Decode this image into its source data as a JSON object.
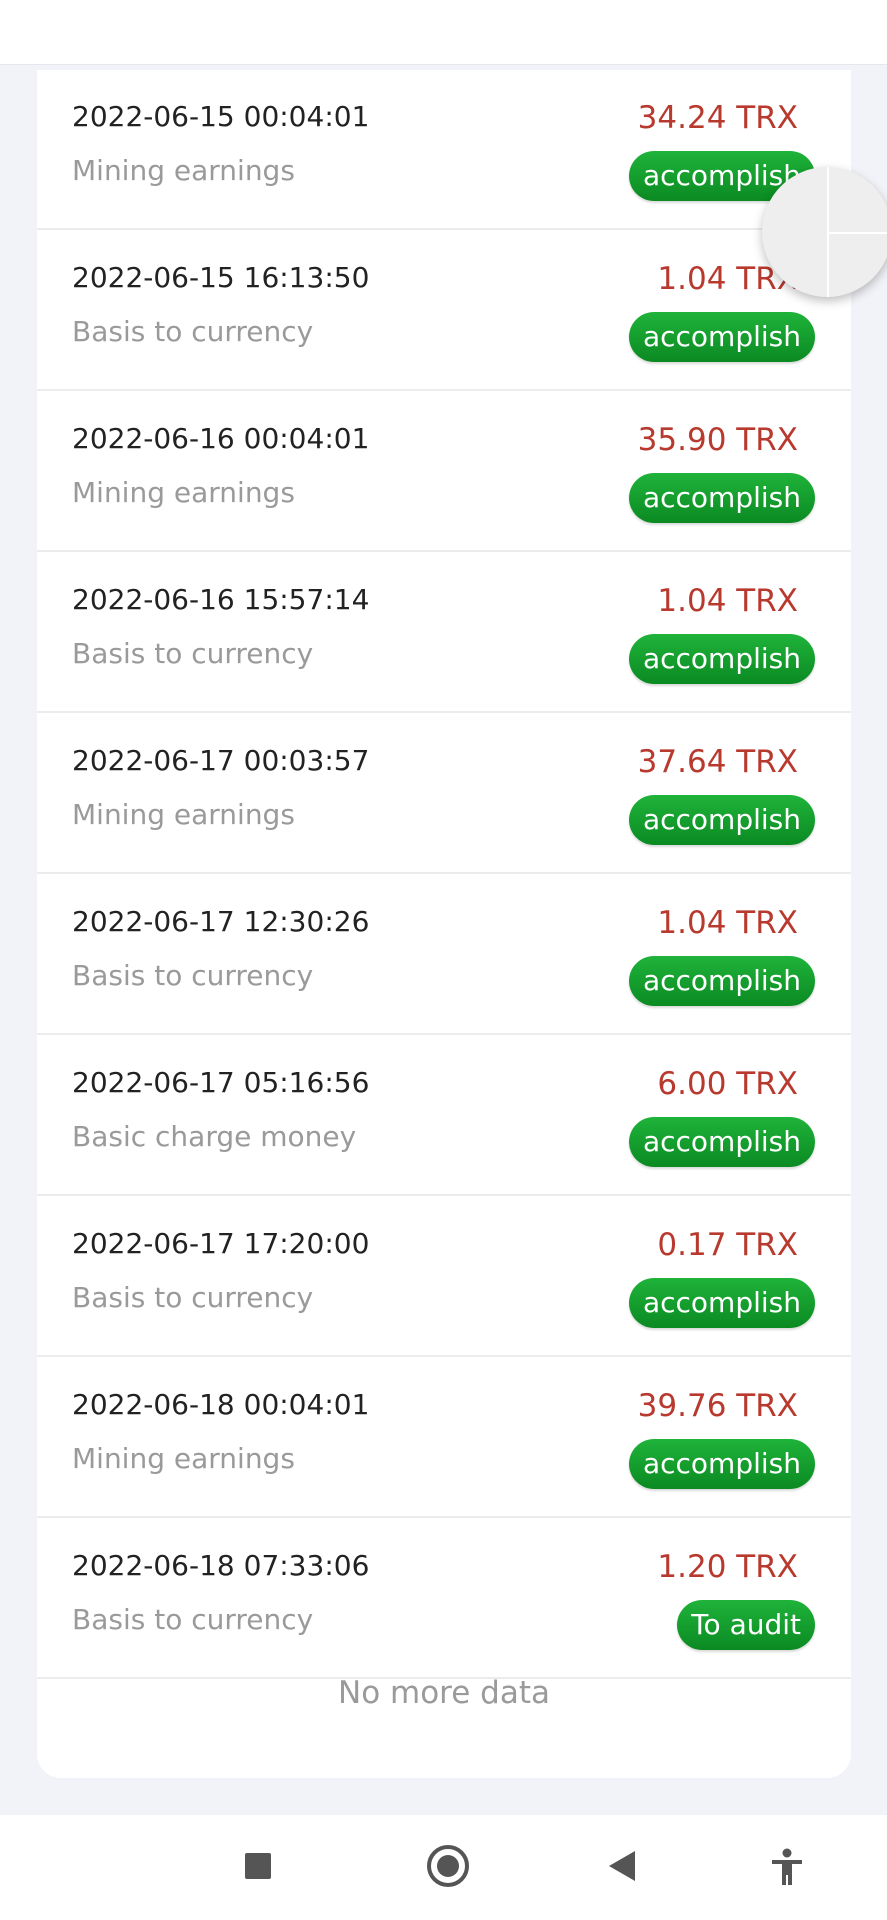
{
  "records": [
    {
      "date": "2022-06-15 00:04:01",
      "description": "Mining earnings",
      "amount": "34.24 TRX",
      "status": "accomplish"
    },
    {
      "date": "2022-06-15 16:13:50",
      "description": "Basis to currency",
      "amount": "1.04 TRX",
      "status": "accomplish"
    },
    {
      "date": "2022-06-16 00:04:01",
      "description": "Mining earnings",
      "amount": "35.90 TRX",
      "status": "accomplish"
    },
    {
      "date": "2022-06-16 15:57:14",
      "description": "Basis to currency",
      "amount": "1.04 TRX",
      "status": "accomplish"
    },
    {
      "date": "2022-06-17 00:03:57",
      "description": "Mining earnings",
      "amount": "37.64 TRX",
      "status": "accomplish"
    },
    {
      "date": "2022-06-17 12:30:26",
      "description": "Basis to currency",
      "amount": "1.04 TRX",
      "status": "accomplish"
    },
    {
      "date": "2022-06-17 05:16:56",
      "description": "Basic charge money",
      "amount": "6.00 TRX",
      "status": "accomplish"
    },
    {
      "date": "2022-06-17 17:20:00",
      "description": "Basis to currency",
      "amount": "0.17 TRX",
      "status": "accomplish"
    },
    {
      "date": "2022-06-18 00:04:01",
      "description": "Mining earnings",
      "amount": "39.76 TRX",
      "status": "accomplish"
    },
    {
      "date": "2022-06-18 07:33:06",
      "description": "Basis to currency",
      "amount": "1.20 TRX",
      "status": "To audit"
    }
  ],
  "footer": {
    "no_more_text": "No more data"
  },
  "colors": {
    "amount": "#b8392e",
    "status_badge": "#13a02f",
    "page_background": "#f2f3f8"
  },
  "icons": {
    "floating_button": "assistive-touch-icon",
    "nav_recent": "square-icon",
    "nav_home": "home-circle-icon",
    "nav_back": "back-triangle-icon",
    "nav_accessibility": "accessibility-icon"
  }
}
